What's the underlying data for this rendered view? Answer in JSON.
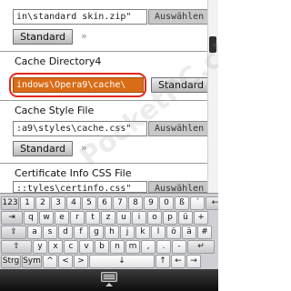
{
  "settings": {
    "row0": {
      "path": "in\\standard skin.zip\"",
      "browse": "Auswählen",
      "standard": "Standard",
      "more": "»"
    },
    "row1": {
      "label": "Cache Directory4",
      "path": "indows\\Opera9\\cache\\",
      "standard": "Standard"
    },
    "row2": {
      "label": "Cache Style File",
      "path": ":a9\\styles\\cache.css\"",
      "browse": "Auswählen",
      "standard": "Standard",
      "more": "»"
    },
    "row3": {
      "label": "Certificate Info CSS File",
      "path": "::tyles\\certinfo.css\"",
      "browse": "Auswählen"
    }
  },
  "watermark": "PocketPC.ch",
  "keyboard": {
    "row1": [
      "123",
      "1",
      "2",
      "3",
      "4",
      "5",
      "6",
      "7",
      "8",
      "9",
      "0",
      "ß",
      "´",
      "←"
    ],
    "row2": [
      "⇥",
      "q",
      "w",
      "e",
      "r",
      "t",
      "z",
      "u",
      "i",
      "o",
      "p",
      "ü",
      "+"
    ],
    "row3": [
      "⇪",
      "a",
      "s",
      "d",
      "f",
      "g",
      "h",
      "j",
      "k",
      "l",
      "ö",
      "ä",
      "#"
    ],
    "row4": [
      "⇧",
      "y",
      "x",
      "c",
      "v",
      "b",
      "n",
      "m",
      ",",
      ".",
      "-",
      "↵"
    ],
    "row5": [
      "Strg",
      "Sym",
      "^",
      "<",
      ">",
      "↓",
      "↑",
      "←",
      "→"
    ]
  },
  "icons": [
    "keyboard-icon",
    "caret-up-icon"
  ],
  "colors": {
    "highlight_field": "#d96c17",
    "highlight_ring": "#e42619"
  }
}
